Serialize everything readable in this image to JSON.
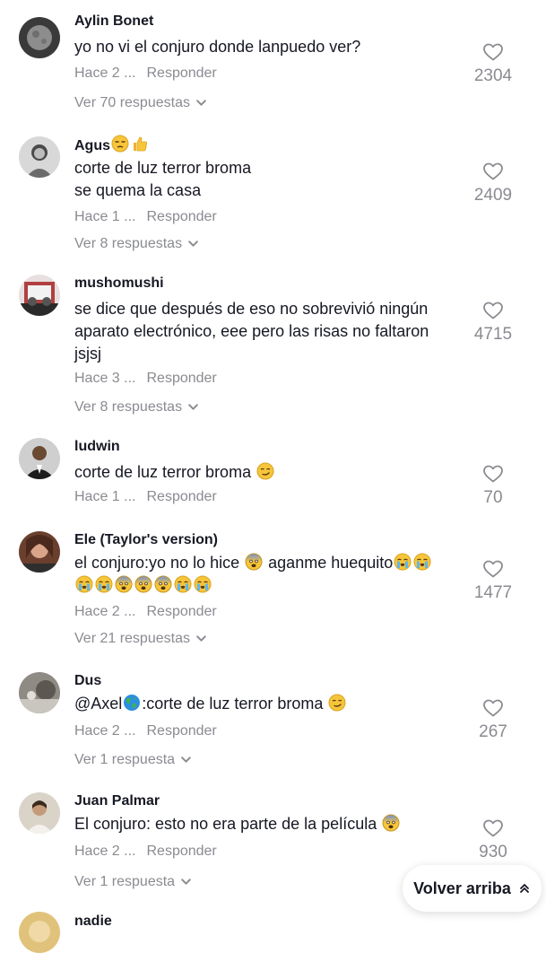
{
  "reply_label": "Responder",
  "back_to_top": "Volver arriba",
  "colors": {
    "text": "#161823",
    "muted": "#8a8b91",
    "background": "#ffffff"
  },
  "comments": [
    {
      "username": "Aylin Bonet",
      "text": "yo no vi el conjuro donde lanpuedo ver?",
      "time": "Hace 2 ...",
      "likes": "2304",
      "replies": "Ver 70 respuestas"
    },
    {
      "username": "Agus",
      "username_emojis": [
        "unamused-face",
        "thumbs-up"
      ],
      "text_line1": "corte de luz terror broma",
      "text_line2": "se quema la casa",
      "time": "Hace 1 ...",
      "likes": "2409",
      "replies": "Ver 8 respuestas"
    },
    {
      "username": "mushomushi",
      "text_line1": "se dice que después de eso no sobrevivió ningún",
      "text_line2": "aparato electrónico, eee pero las risas no faltaron",
      "text_line3": "jsjsj",
      "time": "Hace 3 ...",
      "likes": "4715",
      "replies": "Ver 8 respuestas"
    },
    {
      "username": "ludwin",
      "text": "corte de luz terror broma",
      "text_emojis": [
        "smirking-face"
      ],
      "time": "Hace 1 ...",
      "likes": "70"
    },
    {
      "username": "Ele (Taylor's version)",
      "text_part1": "el conjuro:yo no lo hice",
      "text_part2": "aganme huequito",
      "text_emojis": [
        "anxious-face",
        "crying-face",
        "crying-face",
        "crying-face",
        "crying-face",
        "anxious-face",
        "anxious-face",
        "anxious-face",
        "crying-face",
        "crying-face"
      ],
      "time": "Hace 2 ...",
      "likes": "1477",
      "replies": "Ver 21 respuestas"
    },
    {
      "username": "Dus",
      "mention": "@Axel",
      "text": ":corte de luz terror broma",
      "text_emojis": [
        "globe-icon",
        "smirking-face"
      ],
      "time": "Hace 2 ...",
      "likes": "267",
      "replies": "Ver 1 respuesta"
    },
    {
      "username": "Juan Palmar",
      "text": "El conjuro: esto no era parte de la película",
      "text_emojis": [
        "anxious-face"
      ],
      "time": "Hace 2 ...",
      "likes": "930",
      "replies": "Ver 1 respuesta"
    },
    {
      "username": "nadie"
    }
  ]
}
